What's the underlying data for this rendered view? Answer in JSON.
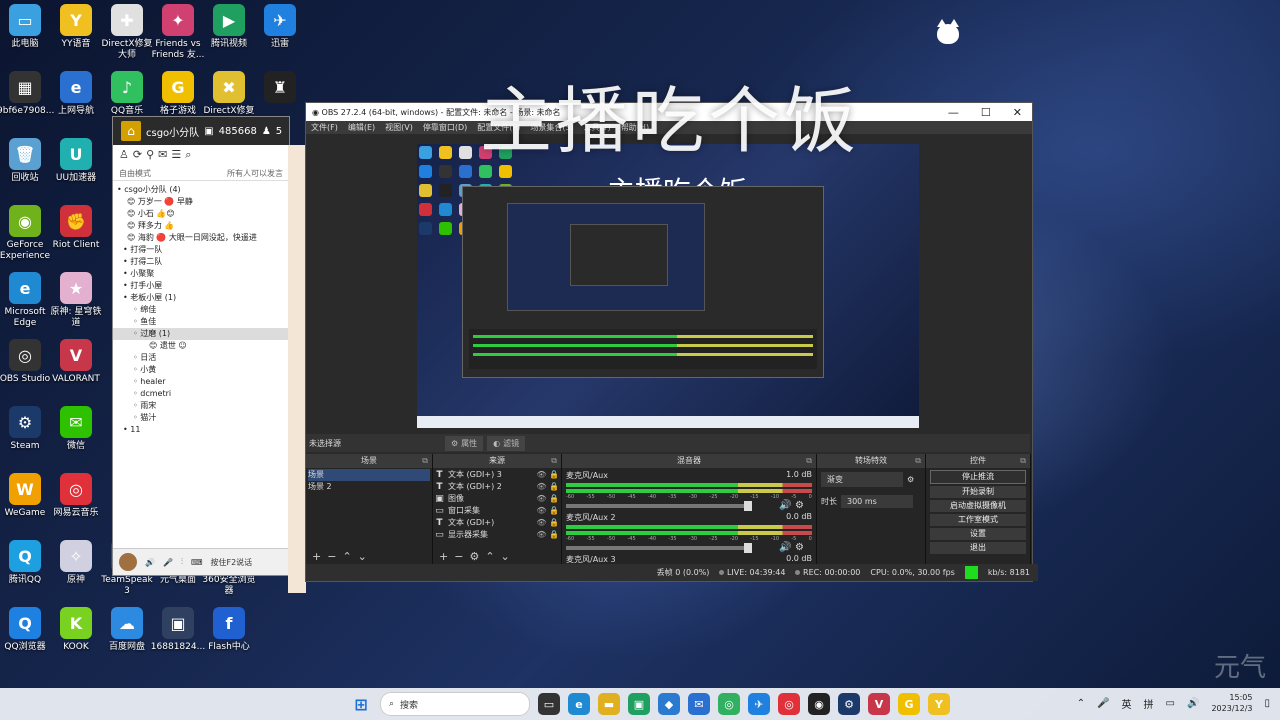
{
  "overlay_title": "主播吃个饭",
  "watermark": "元气",
  "desktop_icons": [
    {
      "label": "此电脑",
      "color": "#3aa0e0",
      "glyph": "▭"
    },
    {
      "label": "YY语音",
      "color": "#f0c020",
      "glyph": "Y"
    },
    {
      "label": "DirectX修复\n大师",
      "color": "#e0e0e0",
      "glyph": "✚"
    },
    {
      "label": "Friends vs\nFriends 友...",
      "color": "#d04070",
      "glyph": "✦"
    },
    {
      "label": "腾讯视频",
      "color": "#20a060",
      "glyph": "▶"
    },
    {
      "label": "迅雷",
      "color": "#2080e0",
      "glyph": "✈"
    },
    {
      "label": "9bf6e7908...",
      "color": "#333",
      "glyph": "▦"
    },
    {
      "label": "上网导航",
      "color": "#2a70d0",
      "glyph": "e"
    },
    {
      "label": "QQ音乐",
      "color": "#30c060",
      "glyph": "♪"
    },
    {
      "label": "格子游戏",
      "color": "#f0c000",
      "glyph": "G"
    },
    {
      "label": "DirectX修复",
      "color": "#e0c030",
      "glyph": "✖"
    },
    {
      "label": "",
      "color": "#222",
      "glyph": "♜"
    },
    {
      "label": "回收站",
      "color": "#5aa0d0",
      "glyph": "🗑"
    },
    {
      "label": "UU加速器",
      "color": "#20b0b0",
      "glyph": "U"
    },
    {
      "label": "GeForce\nExperience",
      "color": "#6fb21b",
      "glyph": "◉"
    },
    {
      "label": "Riot Client",
      "color": "#d0303a",
      "glyph": "✊"
    },
    {
      "label": "Microsoft\nEdge",
      "color": "#1f8ad2",
      "glyph": "e"
    },
    {
      "label": "原神: 星穹铁道",
      "color": "#e4b0d0",
      "glyph": "★"
    },
    {
      "label": "OBS Studio",
      "color": "#333",
      "glyph": "◎"
    },
    {
      "label": "VALORANT",
      "color": "#c8364a",
      "glyph": "V"
    },
    {
      "label": "Steam",
      "color": "#1b3a6a",
      "glyph": "⚙"
    },
    {
      "label": "微信",
      "color": "#2dc100",
      "glyph": "✉"
    },
    {
      "label": "WeGame",
      "color": "#f0a000",
      "glyph": "W"
    },
    {
      "label": "网易云音乐",
      "color": "#e0303a",
      "glyph": "◎"
    },
    {
      "label": "腾讯QQ",
      "color": "#1ea0e0",
      "glyph": "Q"
    },
    {
      "label": "原神",
      "color": "#d0d0e0",
      "glyph": "✧"
    },
    {
      "label": "TeamSpeak\n3",
      "color": "#2a4a80",
      "glyph": "T"
    },
    {
      "label": "元气桌面",
      "color": "#c0a060",
      "glyph": "元"
    },
    {
      "label": "360安全浏览器",
      "color": "#20a050",
      "glyph": "e"
    },
    {
      "label": "QQ浏览器",
      "color": "#1e80e0",
      "glyph": "Q"
    },
    {
      "label": "KOOK",
      "color": "#79d21f",
      "glyph": "K"
    },
    {
      "label": "百度网盘",
      "color": "#2c8ae0",
      "glyph": "☁"
    },
    {
      "label": "16881824...",
      "color": "#304060",
      "glyph": "▣"
    },
    {
      "label": "Flash中心",
      "color": "#2060d0",
      "glyph": "f"
    }
  ],
  "teamspeak": {
    "title": "csgo小分队",
    "stat1": "485668",
    "stat2": "5",
    "mode": "自由模式",
    "mode_right": "所有人可以发言",
    "tree": [
      {
        "text": "• csgo小分队 (4)",
        "indent": 4,
        "sel": false
      },
      {
        "text": "😊 万岁一 🔴 早静",
        "indent": 14,
        "sel": false
      },
      {
        "text": "😊 小石 👍😊",
        "indent": 14,
        "sel": false
      },
      {
        "text": "😊 拜多力 👍",
        "indent": 14,
        "sel": false
      },
      {
        "text": "😊 海豹 🔴 大眼一日网没起，快遥进",
        "indent": 14,
        "sel": false
      },
      {
        "text": "• 打得一队",
        "indent": 10,
        "sel": false
      },
      {
        "text": "• 打得二队",
        "indent": 10,
        "sel": false
      },
      {
        "text": "• 小聚聚",
        "indent": 10,
        "sel": false
      },
      {
        "text": "• 打手小屋",
        "indent": 10,
        "sel": false
      },
      {
        "text": "• 老板小屋 (1)",
        "indent": 10,
        "sel": false
      },
      {
        "text": "◦ 绵佳",
        "indent": 20,
        "sel": false
      },
      {
        "text": "◦ 鱼佳",
        "indent": 20,
        "sel": false
      },
      {
        "text": "◦ 过磨 (1)",
        "indent": 20,
        "sel": true
      },
      {
        "text": "😊 遗世 ☺",
        "indent": 36,
        "sel": false
      },
      {
        "text": "◦ 日活",
        "indent": 20,
        "sel": false
      },
      {
        "text": "◦ 小黄",
        "indent": 20,
        "sel": false
      },
      {
        "text": "◦ healer",
        "indent": 20,
        "sel": false
      },
      {
        "text": "◦ dcmetri",
        "indent": 20,
        "sel": false
      },
      {
        "text": "◦ 雨宋",
        "indent": 20,
        "sel": false
      },
      {
        "text": "◦ 猫汁",
        "indent": 20,
        "sel": false
      },
      {
        "text": "• 11",
        "indent": 10,
        "sel": false
      }
    ],
    "push_to_talk": "按住F2说话"
  },
  "obs": {
    "title": "OBS 27.2.4 (64-bit, windows) - 配置文件: 未命名 - 场景: 未命名",
    "menu": [
      "文件(F)",
      "编辑(E)",
      "视图(V)",
      "停靠窗口(D)",
      "配置文件(P)",
      "场景集合(S)",
      "工具(T)",
      "帮助(H)"
    ],
    "preview_title": "主播吃个饭",
    "no_source": "未选择源",
    "props_label": "属性",
    "filters_label": "滤镜",
    "docks": {
      "scenes": "场景",
      "sources": "来源",
      "mixer": "混音器",
      "transitions": "转场特效",
      "controls": "控件"
    },
    "scenes": [
      "场景",
      "场景 2"
    ],
    "sources": [
      {
        "icon": "T",
        "name": "文本 (GDI+) 3"
      },
      {
        "icon": "T",
        "name": "文本 (GDI+) 2"
      },
      {
        "icon": "▣",
        "name": "图像"
      },
      {
        "icon": "▭",
        "name": "窗口采集"
      },
      {
        "icon": "T",
        "name": "文本 (GDI+)"
      },
      {
        "icon": "▭",
        "name": "显示器采集"
      }
    ],
    "mixer": [
      {
        "name": "麦克风/Aux",
        "db": "1.0 dB"
      },
      {
        "name": "麦克风/Aux 2",
        "db": "0.0 dB"
      },
      {
        "name": "麦克风/Aux 3",
        "db": "0.0 dB"
      }
    ],
    "mixer_scale": [
      "-60",
      "-55",
      "-50",
      "-45",
      "-40",
      "-35",
      "-30",
      "-25",
      "-20",
      "-15",
      "-10",
      "-5",
      "0"
    ],
    "transition": "渐变",
    "duration_label": "时长",
    "duration_value": "300 ms",
    "controls": [
      "停止推流",
      "开始录制",
      "启动虚拟摄像机",
      "工作室模式",
      "设置",
      "退出"
    ],
    "status": {
      "dropped": "丢帧 0 (0.0%)",
      "live": "LIVE: 04:39:44",
      "rec": "REC: 00:00:00",
      "cpu": "CPU: 0.0%, 30.00 fps",
      "kbps": "kb/s: 8181"
    }
  },
  "taskbar": {
    "search": "搜索",
    "apps": [
      {
        "glyph": "▭",
        "color": "#333"
      },
      {
        "glyph": "e",
        "color": "#1f8ad2"
      },
      {
        "glyph": "▬",
        "color": "#e0b020"
      },
      {
        "glyph": "▣",
        "color": "#1fa060"
      },
      {
        "glyph": "◆",
        "color": "#2a7ad0"
      },
      {
        "glyph": "✉",
        "color": "#2a70d0"
      },
      {
        "glyph": "◎",
        "color": "#30b060"
      },
      {
        "glyph": "✈",
        "color": "#2080e0"
      },
      {
        "glyph": "◎",
        "color": "#e0303a"
      },
      {
        "glyph": "◉",
        "color": "#222"
      },
      {
        "glyph": "⚙",
        "color": "#1b3a6a"
      },
      {
        "glyph": "V",
        "color": "#c8364a"
      },
      {
        "glyph": "G",
        "color": "#f0c000"
      },
      {
        "glyph": "Y",
        "color": "#f0c020"
      }
    ],
    "tray": {
      "lang1": "英",
      "lang2": "拼",
      "time": "15:05",
      "date": "2023/12/3"
    }
  }
}
